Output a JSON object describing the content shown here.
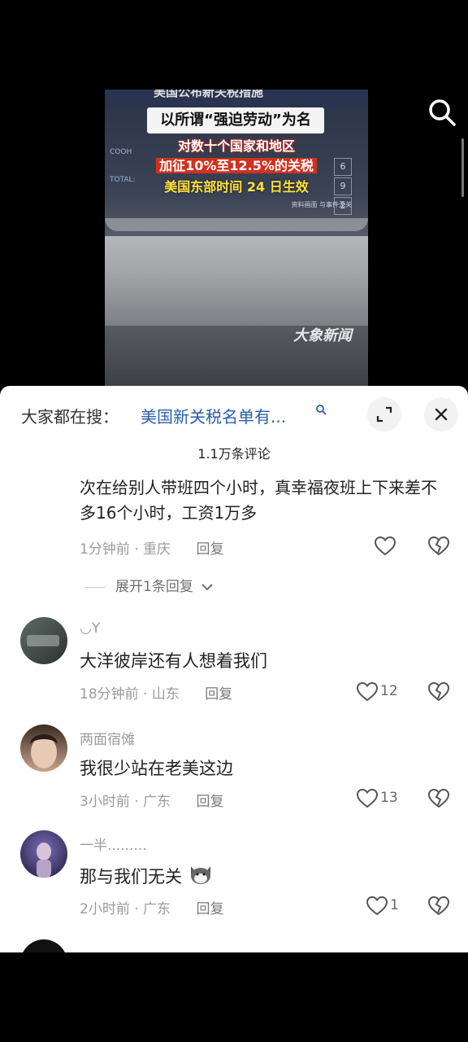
{
  "video": {
    "top_title": "美国公布新关税措施",
    "caption_box": "以所谓“强迫劳动”为名",
    "caption_line1": "对数十个国家和地区",
    "caption_line2": "加征10%至12.5%的关税",
    "caption_line3": "美国东部时间 24 日生效",
    "screen_label1": "COOH",
    "screen_label2": "TOTAL:",
    "keypad": [
      "6",
      "9",
      "2"
    ],
    "source_note": "资料画面 与事件无关",
    "watermark": "大象新闻"
  },
  "search_bar": {
    "prefix": "大家都在搜：",
    "query": "美国新关税名单有..."
  },
  "comments_count": "1.1万条评论",
  "comments": [
    {
      "text": "次在给别人带班四个小时，真幸福夜班上下来差不多16个小时，工资1万多",
      "time": "1分钟前",
      "location": "重庆",
      "reply": "回复",
      "likes": "",
      "expand": "展开1条回复"
    },
    {
      "username": "◡Y",
      "text": "大洋彼岸还有人想着我们",
      "time": "18分钟前",
      "location": "山东",
      "reply": "回复",
      "likes": "12"
    },
    {
      "username": "两面宿傩",
      "text": "我很少站在老美这边",
      "time": "3小时前",
      "location": "广东",
      "reply": "回复",
      "likes": "13"
    },
    {
      "username": "一半.........",
      "text": "那与我们无关",
      "time": "2小时前",
      "location": "广东",
      "reply": "回复",
      "likes": "1"
    }
  ],
  "colors": {
    "query_blue": "#2a5ea8",
    "meta_gray": "#9b9b9b",
    "sheet_bg": "#ffffff"
  }
}
